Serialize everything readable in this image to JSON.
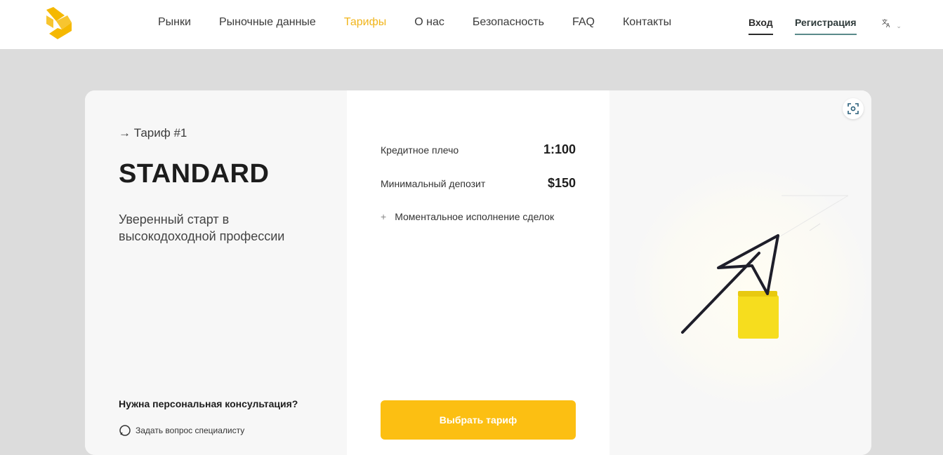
{
  "header": {
    "nav": [
      "Рынки",
      "Рыночные данные",
      "Тарифы",
      "О нас",
      "Безопасность",
      "FAQ",
      "Контакты"
    ],
    "active_nav": "Тарифы",
    "login": "Вход",
    "register": "Регистрация",
    "lang_icon": "translate-icon"
  },
  "plan": {
    "number_label": "→ Тариф #1",
    "name": "STANDARD",
    "description": "Уверенный старт в высокодоходной профессии",
    "consult_title": "Нужна персональная консультация?",
    "consult_link": "Задать вопрос специалисту",
    "specs": [
      {
        "label": "Кредитное плечо",
        "value": "1:100"
      },
      {
        "label": "Минимальный депозит",
        "value": "$150"
      }
    ],
    "features": [
      "Моментальное исполнение сделок"
    ],
    "button": "Выбрать тариф"
  },
  "colors": {
    "accent": "#f1b51c",
    "button": "#fcbf12",
    "background": "#dcdcdc"
  }
}
